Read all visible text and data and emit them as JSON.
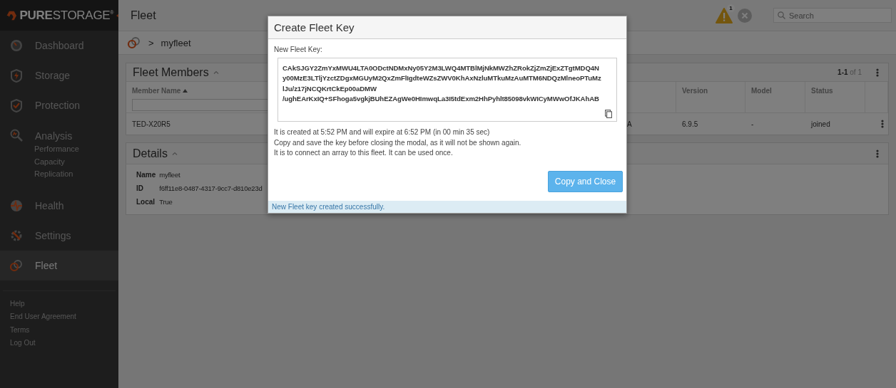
{
  "sidebar": {
    "logo": "**PURE**STORAGE$^{®}$",
    "nav": [
      {
        "label": "Dashboard",
        "selected": false
      },
      {
        "label": "Storage",
        "selected": false
      },
      {
        "label": "Protection",
        "selected": false
      },
      {
        "label": "Analysis",
        "selected": false,
        "children": [
          {
            "label": "Performance"
          },
          {
            "label": "Capacity"
          },
          {
            "label": "Replication"
          }
        ]
      },
      {
        "label": "Health",
        "selected": false
      },
      {
        "label": "Settings",
        "selected": false
      },
      {
        "label": "Fleet",
        "selected": true
      }
    ],
    "footer_links": [
      "Help",
      "End User Agreement",
      "Terms",
      "Log Out"
    ]
  },
  "header": {
    "title": "Fleet",
    "alert_count": "1",
    "search": {
      "placeholder": "Search"
    }
  },
  "breadcrumb": {
    "separator": ">",
    "current": "myfleet"
  },
  "members": {
    "title": "Fleet Members",
    "pagination": "**1-1** of 1",
    "columns": [
      {
        "label": "Member Name",
        "sorted": true
      },
      {},
      {
        "label": "Version",
        "sorted": false
      },
      {
        "label": "Model",
        "sorted": false
      },
      {
        "label": "Status",
        "sorted": false
      }
    ],
    "rows": [
      {
        "cells": [
          "TED-X20R5",
          "A",
          "6.9.5",
          "-",
          "joined"
        ]
      }
    ]
  },
  "details": {
    "title": "Details",
    "fields": [
      {
        "label": "Name",
        "value": "myfleet"
      },
      {
        "label": "ID",
        "value": "f6ff11e8-0487-4317-9cc7-d810e23d"
      },
      {
        "label": "Local",
        "value": "True"
      }
    ]
  },
  "modal": {
    "title": "Create Fleet Key",
    "key_label": "New Fleet Key:",
    "key_lines": [
      "CAkSJGY2ZmYxMWU4LTA0ODctNDMxNy05Y2M3LWQ4MTBlMjNkMWZhZRokZjZmZjExZTgtMDQ4N",
      "y00MzE3LTljYzctZDgxMGUyM2QxZmFlIgdteWZsZWV0KhAxNzluMTkuMzAuMTM6NDQzMlneoPTuMz",
      "lJu/z17jNCQKrtCkEp00aDMW",
      "/ughEArKxIQ+SFhoga5vgkjBUhEZAgWe0HImwqLa3I5tdExm2HhPyhlt85098vkWICyMWwOfJKAhAB"
    ],
    "messages": [
      "It is created at 5:52 PM and will expire at 6:52 PM (in 00 min 35 sec)",
      "Copy and save the key before closing the modal, as it will not be shown again.",
      "It is to connect an array to this fleet. It can be used once."
    ],
    "button": "Copy and Close",
    "status": "New Fleet key created successfully."
  }
}
